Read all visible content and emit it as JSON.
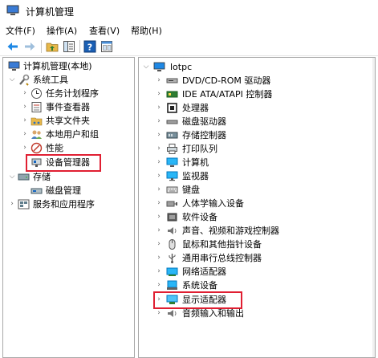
{
  "window": {
    "title": "计算机管理"
  },
  "menu": {
    "file": "文件(F)",
    "action": "操作(A)",
    "view": "查看(V)",
    "help": "帮助(H)"
  },
  "left_tree": {
    "root": "计算机管理(本地)",
    "system_tools": "系统工具",
    "task_scheduler": "任务计划程序",
    "event_viewer": "事件查看器",
    "shared_folders": "共享文件夹",
    "local_users": "本地用户和组",
    "performance": "性能",
    "device_manager": "设备管理器",
    "storage": "存储",
    "disk_management": "磁盘管理",
    "services_apps": "服务和应用程序"
  },
  "right_tree": {
    "root": "lotpc",
    "items": [
      "DVD/CD-ROM 驱动器",
      "IDE ATA/ATAPI 控制器",
      "处理器",
      "磁盘驱动器",
      "存储控制器",
      "打印队列",
      "计算机",
      "监视器",
      "键盘",
      "人体学输入设备",
      "软件设备",
      "声音、视频和游戏控制器",
      "鼠标和其他指针设备",
      "通用串行总线控制器",
      "网络适配器",
      "系统设备",
      "显示适配器",
      "音频输入和输出"
    ]
  },
  "colors": {
    "highlight_border": "#e01f32",
    "accent_blue": "#1e88e5"
  }
}
